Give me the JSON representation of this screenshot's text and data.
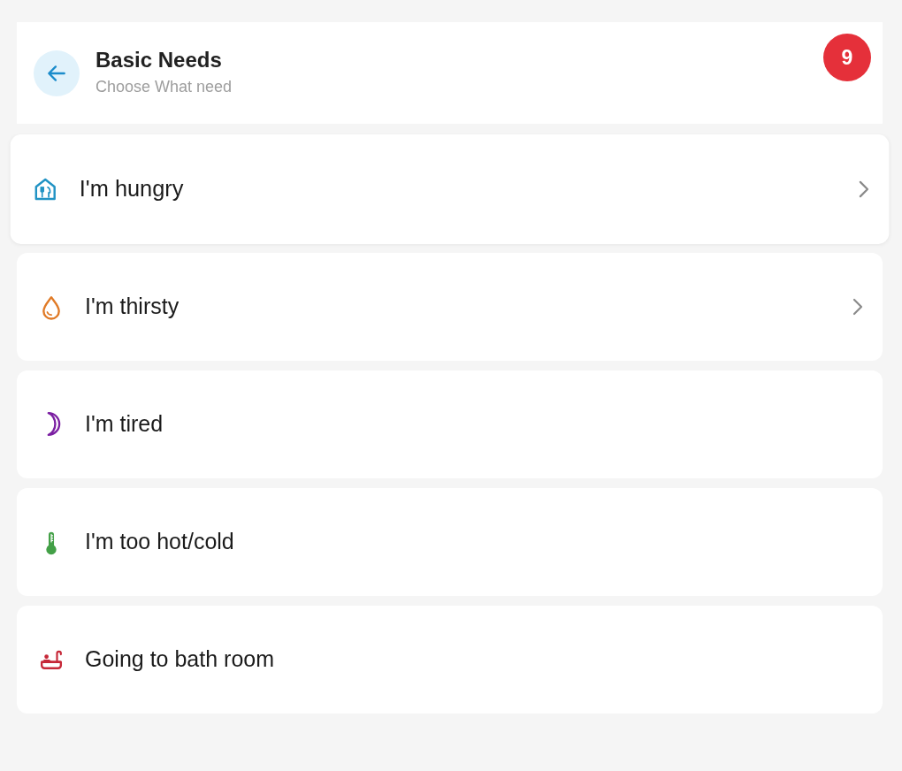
{
  "header": {
    "title": "Basic Needs",
    "subtitle": "Choose What need",
    "badge": "9"
  },
  "items": [
    {
      "label": "I'm hungry",
      "kind": "food",
      "color": "#2193c4",
      "chevron": true,
      "hovered": true
    },
    {
      "label": "I'm thirsty",
      "kind": "drop",
      "color": "#e07a26",
      "chevron": true,
      "hovered": false
    },
    {
      "label": "I'm tired",
      "kind": "moon",
      "color": "#7b1fa2",
      "chevron": false,
      "hovered": false
    },
    {
      "label": "I'm too hot/cold",
      "kind": "thermometer",
      "color": "#43a047",
      "chevron": false,
      "hovered": false
    },
    {
      "label": "Going to bath room",
      "kind": "bath",
      "color": "#c62838",
      "chevron": false,
      "hovered": false
    }
  ]
}
